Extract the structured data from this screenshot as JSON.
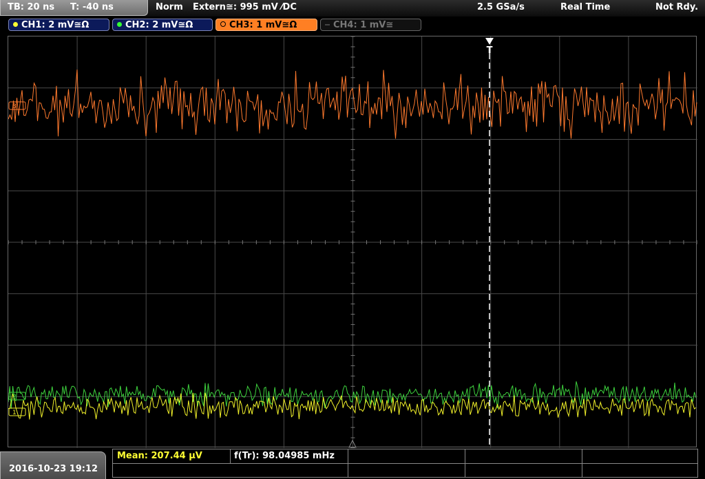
{
  "topbar": {
    "timebase": "TB: 20 ns",
    "trigger_time": "T: -40 ns",
    "mode": "Norm",
    "trigger_source": "Extern≅: 995 mV ⁄DC",
    "sample_rate": "2.5 GSa/s",
    "acquisition": "Real Time",
    "status": "Not Rdy."
  },
  "channels": [
    {
      "label": "CH1: 2 mV≅Ω",
      "color": "#ffff33",
      "active": true
    },
    {
      "label": "CH2: 2 mV≅Ω",
      "color": "#33ff33",
      "active": true
    },
    {
      "label": "CH3: 1 mV≅Ω",
      "color": "#ff7f23",
      "active": true,
      "selected": true
    },
    {
      "label": "CH4: 1 mV≅",
      "color": "#555555",
      "active": false
    }
  ],
  "markers": {
    "trigger_label": "T",
    "ch3_marker": "3",
    "ch2_marker": "2",
    "ch1_marker": "1"
  },
  "bottom": {
    "datetime": "2016-10-23 19:12",
    "mean": "Mean: 207.44 µV",
    "freq": "f(Tr): 98.04985 mHz"
  },
  "colors": {
    "ch1": "#f2f22a",
    "ch2": "#3ed43e",
    "ch3": "#ff7a2e",
    "grid": "#4a4a4a",
    "mean_text": "#ffff33"
  }
}
